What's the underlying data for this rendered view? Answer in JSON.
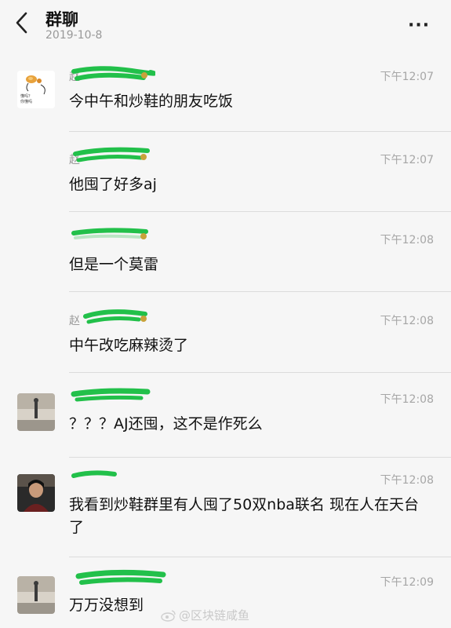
{
  "header": {
    "title": "群聊",
    "date": "2019-10-8",
    "back_icon": "chevron-left-icon",
    "more_icon": "more-dots-icon",
    "more_label": "···"
  },
  "messages": [
    {
      "sender": "赵",
      "time": "下午12:07",
      "text": "今中午和炒鞋的朋友吃饭",
      "avatar": "cartoon-avatar"
    },
    {
      "sender": "赵",
      "time": "下午12:07",
      "text": "他囤了好多aj"
    },
    {
      "sender": "",
      "time": "下午12:08",
      "text": "但是一个莫雷"
    },
    {
      "sender": "赵",
      "time": "下午12:08",
      "text": "中午改吃麻辣烫了"
    },
    {
      "sender": "",
      "time": "下午12:08",
      "text": "？？？AJ还囤，这不是作死么",
      "avatar": "photo-avatar"
    },
    {
      "sender": "",
      "time": "下午12:08",
      "text": "我看到炒鞋群里有人囤了50双nba联名 现在人在天台了",
      "avatar": "photo-avatar"
    },
    {
      "sender": "",
      "time": "下午12:09",
      "text": "万万没想到",
      "avatar": "photo-avatar"
    }
  ],
  "watermark": "@区块链咸鱼",
  "colors": {
    "background": "#f6f6f6",
    "redaction": "#22c04a",
    "timestamp": "#a6a6a6"
  }
}
